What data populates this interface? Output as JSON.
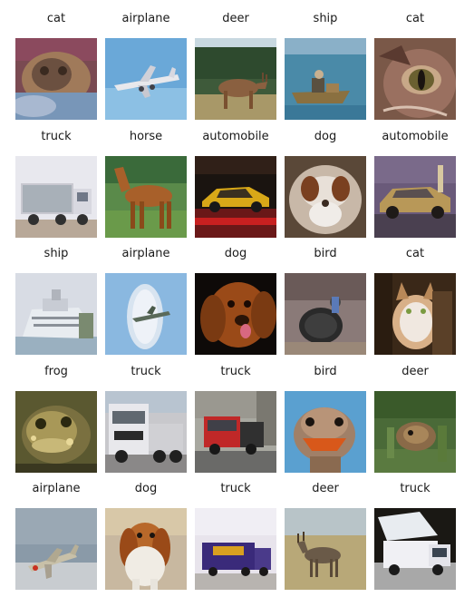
{
  "grid": {
    "cells": [
      {
        "label": "cat"
      },
      {
        "label": "airplane"
      },
      {
        "label": "deer"
      },
      {
        "label": "ship"
      },
      {
        "label": "cat"
      },
      {
        "label": "truck"
      },
      {
        "label": "horse"
      },
      {
        "label": "automobile"
      },
      {
        "label": "dog"
      },
      {
        "label": "automobile"
      },
      {
        "label": "ship"
      },
      {
        "label": "airplane"
      },
      {
        "label": "dog"
      },
      {
        "label": "bird"
      },
      {
        "label": "cat"
      },
      {
        "label": "frog"
      },
      {
        "label": "truck"
      },
      {
        "label": "truck"
      },
      {
        "label": "bird"
      },
      {
        "label": "deer"
      },
      {
        "label": "airplane"
      },
      {
        "label": "dog"
      },
      {
        "label": "truck"
      },
      {
        "label": "deer"
      },
      {
        "label": "truck"
      }
    ]
  }
}
